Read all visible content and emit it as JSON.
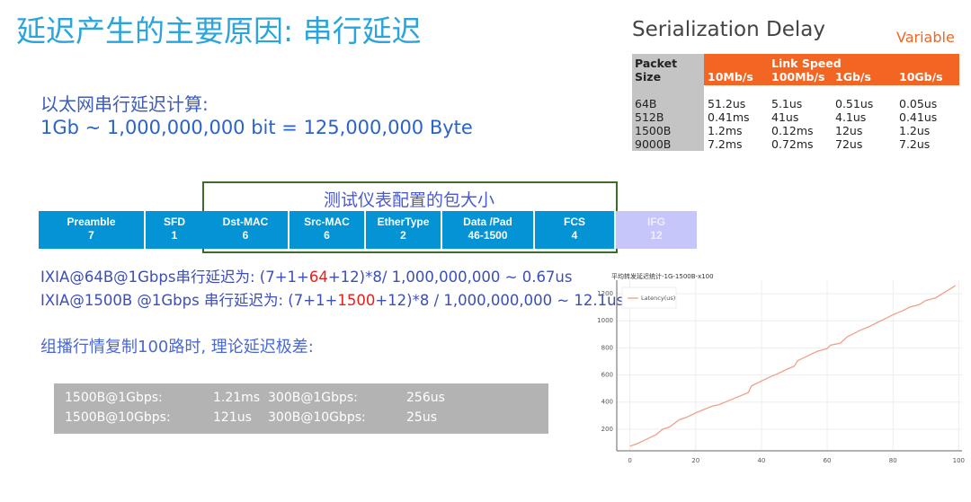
{
  "title": "延迟产生的主要原因: 串行延迟",
  "serialization": {
    "heading": "Serialization Delay",
    "variable": "Variable",
    "table": {
      "packet_header": "Packet",
      "size_header": "Size",
      "link_speed": "Link Speed",
      "columns": [
        "10Mb/s",
        "100Mb/s",
        "1Gb/s",
        "10Gb/s"
      ],
      "rows": [
        {
          "size": "64B",
          "values": [
            "51.2us",
            "5.1us",
            "0.51us",
            "0.05us"
          ]
        },
        {
          "size": "512B",
          "values": [
            "0.41ms",
            "41us",
            "4.1us",
            "0.41us"
          ]
        },
        {
          "size": "1500B",
          "values": [
            "1.2ms",
            "0.12ms",
            "12us",
            "1.2us"
          ]
        },
        {
          "size": "9000B",
          "values": [
            "7.2ms",
            "0.72ms",
            "72us",
            "7.2us"
          ]
        }
      ]
    }
  },
  "calc": {
    "label": "以太网串行延迟计算:",
    "formula": "1Gb ~ 1,000,000,000 bit = 125,000,000 Byte"
  },
  "frame": {
    "box_label": "测试仪表配置的包大小",
    "fields": [
      {
        "name": "Preamble",
        "bytes": "7"
      },
      {
        "name": "SFD",
        "bytes": "1"
      },
      {
        "name": "Dst-MAC",
        "bytes": "6"
      },
      {
        "name": "Src-MAC",
        "bytes": "6"
      },
      {
        "name": "EtherType",
        "bytes": "2"
      },
      {
        "name": "Data /Pad",
        "bytes": "46-1500"
      },
      {
        "name": "FCS",
        "bytes": "4"
      },
      {
        "name": "IFG",
        "bytes": "12"
      }
    ]
  },
  "ixia": [
    {
      "pre": "IXIA@64B@1Gbps串行延迟为: (7+1+",
      "hl": "64",
      "post": "+12)*8/ 1,000,000,000 ~ 0.67us"
    },
    {
      "pre": "IXIA@1500B @1Gbps 串行延迟为: (7+1+",
      "hl": "1500",
      "post": "+12)*8 / 1,000,000,000 ~ 12.1us"
    }
  ],
  "multicast": {
    "label": "组播行情复制100路时, 理论延迟极差:",
    "rows": [
      [
        "1500B@1Gbps:",
        "1.21ms",
        "300B@1Gbps:",
        "256us"
      ],
      [
        "1500B@10Gbps:",
        "121us",
        "300B@10Gbps:",
        "25us"
      ]
    ]
  },
  "colors": {
    "title": "#2aa5dc",
    "orange": "#f26522",
    "frame": "#0494d6",
    "ifg": "#c6c6fa",
    "line": "#f0a08a"
  },
  "chart_data": {
    "type": "line",
    "title": "平均转发延迟统计-1G-1500B-x100",
    "xlim": [
      -4,
      101
    ],
    "ylim": [
      40,
      1300
    ],
    "xticks": [
      0,
      20,
      40,
      60,
      80,
      100
    ],
    "yticks": [
      200,
      400,
      600,
      800,
      1000,
      1200
    ],
    "grid": true,
    "legend": "top-left",
    "series": [
      {
        "name": "Latency(us)",
        "x": [
          0,
          2,
          5,
          8,
          10,
          12,
          15,
          17,
          20,
          22,
          25,
          27,
          30,
          33,
          36,
          37,
          40,
          43,
          45,
          48,
          50,
          51,
          54,
          57,
          60,
          61,
          64,
          66,
          70,
          73,
          75,
          78,
          80,
          83,
          85,
          88,
          90,
          93,
          95,
          99
        ],
        "y": [
          75,
          90,
          125,
          160,
          200,
          215,
          270,
          285,
          320,
          340,
          370,
          380,
          410,
          440,
          470,
          520,
          555,
          590,
          610,
          645,
          665,
          705,
          740,
          775,
          795,
          820,
          835,
          880,
          930,
          960,
          985,
          1020,
          1045,
          1075,
          1100,
          1120,
          1150,
          1170,
          1200,
          1260
        ]
      }
    ]
  }
}
